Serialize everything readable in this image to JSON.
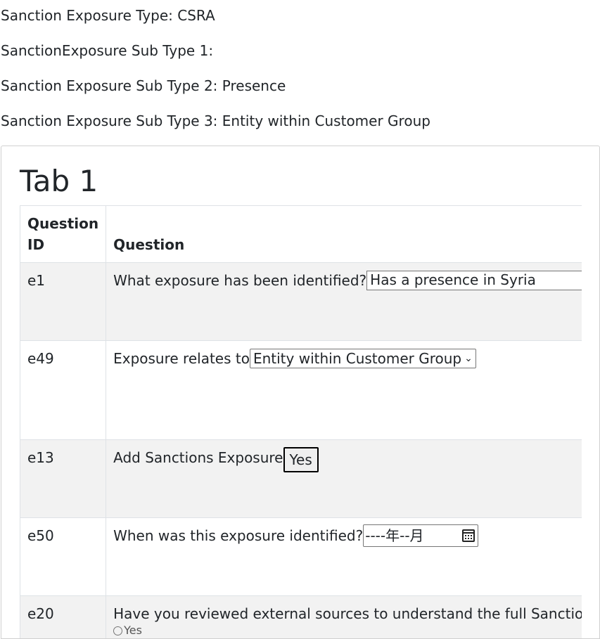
{
  "header": {
    "exposure_type": "Sanction Exposure Type: CSRA",
    "sub_type_1": "SanctionExposure Sub Type 1:",
    "sub_type_2": "Sanction Exposure Sub Type 2: Presence",
    "sub_type_3": "Sanction Exposure Sub Type 3: Entity within Customer Group"
  },
  "tab": {
    "title": "Tab 1"
  },
  "table": {
    "columns": [
      "Question\nID",
      "Question"
    ],
    "col_id_line1": "Question",
    "col_id_line2": "ID",
    "col_question": "Question",
    "rows": [
      {
        "id": "e1",
        "question": "What exposure has been identified?",
        "input_value": "Has a presence in Syria"
      },
      {
        "id": "e49",
        "question": "Exposure relates to",
        "select_value": "Entity within Customer Group"
      },
      {
        "id": "e13",
        "question": "Add Sanctions Exposure",
        "button_label": "Yes"
      },
      {
        "id": "e50",
        "question": "When was this exposure identified?",
        "date_value": "----年--月"
      },
      {
        "id": "e20",
        "question": "Have you reviewed external sources to understand the full Sanctions Expo",
        "radio_label": "Yes"
      }
    ]
  },
  "icons": {
    "select_chevron": "chevron-down-icon",
    "date_picker": "calendar-icon",
    "radio": "radio-button-icon"
  }
}
